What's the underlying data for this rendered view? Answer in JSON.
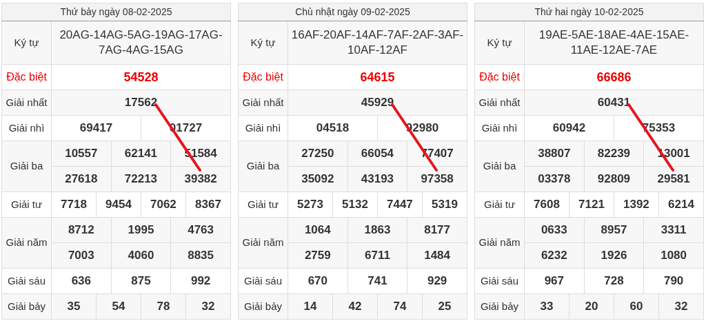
{
  "days": [
    {
      "title": "Thứ bảy ngày 08-02-2025",
      "code_label": "Ký tự",
      "codes": "20AG-14AG-5AG-19AG-17AG-7AG-4AG-15AG",
      "rows": [
        {
          "label": "Đặc biệt",
          "kind": "special",
          "numbers": [
            "54528"
          ]
        },
        {
          "label": "Giải nhất",
          "kind": "normal",
          "numbers": [
            "17562"
          ]
        },
        {
          "label": "Giải nhì",
          "kind": "normal",
          "numbers": [
            "69417",
            "01727"
          ]
        },
        {
          "label": "Giải ba",
          "kind": "normal",
          "numbers": [
            "10557",
            "62141",
            "51584",
            "27618",
            "72213",
            "39382"
          ]
        },
        {
          "label": "Giải tư",
          "kind": "normal",
          "numbers": [
            "7718",
            "9454",
            "7062",
            "8367"
          ]
        },
        {
          "label": "Giải năm",
          "kind": "normal",
          "numbers": [
            "8712",
            "1995",
            "4763",
            "7003",
            "4060",
            "8835"
          ]
        },
        {
          "label": "Giải sáu",
          "kind": "normal",
          "numbers": [
            "636",
            "875",
            "992"
          ]
        },
        {
          "label": "Giải bảy",
          "kind": "normal",
          "numbers": [
            "35",
            "54",
            "78",
            "32"
          ]
        }
      ]
    },
    {
      "title": "Chủ nhật ngày 09-02-2025",
      "code_label": "Ký tự",
      "codes": "16AF-20AF-14AF-7AF-2AF-3AF-10AF-12AF",
      "rows": [
        {
          "label": "Đặc biệt",
          "kind": "special",
          "numbers": [
            "64615"
          ]
        },
        {
          "label": "Giải nhất",
          "kind": "normal",
          "numbers": [
            "45929"
          ]
        },
        {
          "label": "Giải nhì",
          "kind": "normal",
          "numbers": [
            "04518",
            "92980"
          ]
        },
        {
          "label": "Giải ba",
          "kind": "normal",
          "numbers": [
            "27250",
            "66054",
            "77407",
            "35092",
            "43193",
            "97358"
          ]
        },
        {
          "label": "Giải tư",
          "kind": "normal",
          "numbers": [
            "5273",
            "5132",
            "7447",
            "5319"
          ]
        },
        {
          "label": "Giải năm",
          "kind": "normal",
          "numbers": [
            "1064",
            "1863",
            "8177",
            "2759",
            "6711",
            "1484"
          ]
        },
        {
          "label": "Giải sáu",
          "kind": "normal",
          "numbers": [
            "670",
            "741",
            "929"
          ]
        },
        {
          "label": "Giải bảy",
          "kind": "normal",
          "numbers": [
            "14",
            "42",
            "74",
            "25"
          ]
        }
      ]
    },
    {
      "title": "Thứ hai ngày 10-02-2025",
      "code_label": "Ký tự",
      "codes": "19AE-5AE-18AE-4AE-15AE-11AE-12AE-7AE",
      "rows": [
        {
          "label": "Đặc biệt",
          "kind": "special",
          "numbers": [
            "66686"
          ]
        },
        {
          "label": "Giải nhất",
          "kind": "normal",
          "numbers": [
            "60431"
          ]
        },
        {
          "label": "Giải nhì",
          "kind": "normal",
          "numbers": [
            "60942",
            "75353"
          ]
        },
        {
          "label": "Giải ba",
          "kind": "normal",
          "numbers": [
            "38807",
            "82239",
            "13001",
            "03378",
            "92809",
            "29581"
          ]
        },
        {
          "label": "Giải tư",
          "kind": "normal",
          "numbers": [
            "7608",
            "7121",
            "1392",
            "6214"
          ]
        },
        {
          "label": "Giải năm",
          "kind": "normal",
          "numbers": [
            "0633",
            "8957",
            "3311",
            "6232",
            "1926",
            "1080"
          ]
        },
        {
          "label": "Giải sáu",
          "kind": "normal",
          "numbers": [
            "967",
            "728",
            "790"
          ]
        },
        {
          "label": "Giải bảy",
          "kind": "normal",
          "numbers": [
            "33",
            "20",
            "60",
            "32"
          ]
        }
      ]
    }
  ]
}
